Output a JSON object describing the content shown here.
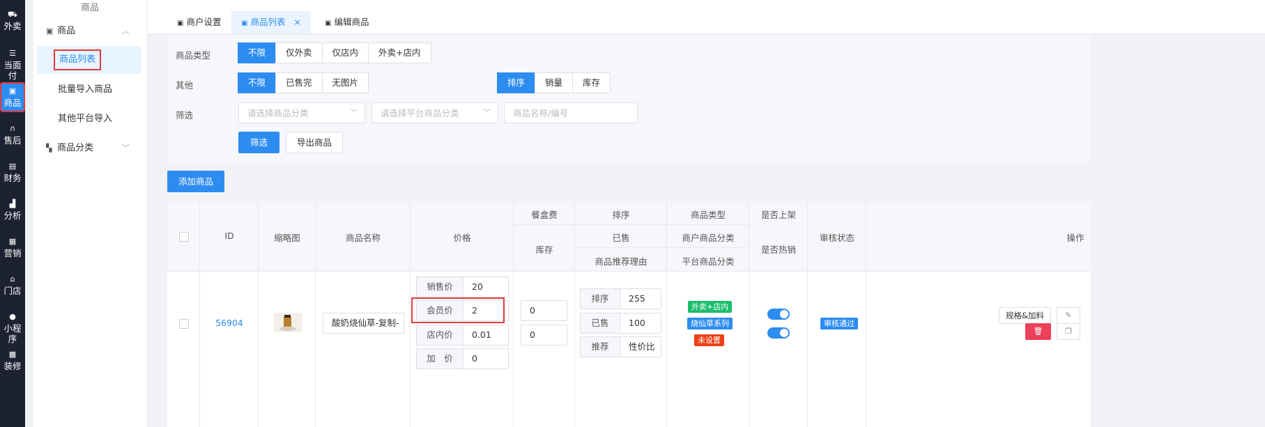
{
  "rail": [
    {
      "icon": "takeout-icon",
      "glyph": "⛟",
      "label": "外卖"
    },
    {
      "icon": "list-icon",
      "glyph": "☰",
      "label": "当面付"
    },
    {
      "icon": "shop-basket-icon",
      "glyph": "▣",
      "label": "商品",
      "active": true
    },
    {
      "icon": "headset-icon",
      "glyph": "∩",
      "label": "售后"
    },
    {
      "icon": "finance-icon",
      "glyph": "▤",
      "label": "财务"
    },
    {
      "icon": "bar-chart-icon",
      "glyph": "▟",
      "label": "分析"
    },
    {
      "icon": "gift-icon",
      "glyph": "▦",
      "label": "营销"
    },
    {
      "icon": "store-icon",
      "glyph": "⌂",
      "label": "门店"
    },
    {
      "icon": "chat-icon",
      "glyph": "●",
      "label": "小程序"
    },
    {
      "icon": "decorate-icon",
      "glyph": "▩",
      "label": "装修"
    }
  ],
  "submenu": {
    "group_title": "商品",
    "goods_group": "商品",
    "items": [
      "商品列表",
      "批量导入商品",
      "其他平台导入"
    ],
    "category_group": "商品分类"
  },
  "tabs": [
    {
      "label": "商户设置"
    },
    {
      "label": "商品列表",
      "close": "×"
    },
    {
      "label": "编辑商品"
    }
  ],
  "filters": {
    "goods_type_label": "商品类型",
    "goods_type_options": [
      "不限",
      "仅外卖",
      "仅店内",
      "外卖+店内"
    ],
    "other_label": "其他",
    "other_options": [
      "不限",
      "已售完",
      "无图片"
    ],
    "sort_options": [
      "排序",
      "销量",
      "库存"
    ],
    "screen_label": "筛选",
    "category_placeholder": "请选择商品分类",
    "platform_category_placeholder": "请选择平台商品分类",
    "name_placeholder": "商品名称/编号",
    "filter_button": "筛选",
    "export_button": "导出商品"
  },
  "add_button": "添加商品",
  "table": {
    "headers": {
      "id": "ID",
      "thumb": "缩略图",
      "name": "商品名称",
      "price": "价格",
      "box_fee": "餐盒费",
      "stock": "库存",
      "sort": "排序",
      "sold": "已售",
      "recommend_reason": "商品推荐理由",
      "goods_type": "商品类型",
      "merchant_category": "商户商品分类",
      "platform_category": "平台商品分类",
      "on_shelf": "是否上架",
      "hot": "是否热销",
      "audit": "审核状态",
      "ops": "操作"
    },
    "row": {
      "id": "56904",
      "name": "酸奶烧仙草-复制-",
      "prices": [
        {
          "k": "销售价",
          "v": "20"
        },
        {
          "k": "会员价",
          "v": "2"
        },
        {
          "k": "店内价",
          "v": "0.01"
        },
        {
          "k": "加　价",
          "v": "0"
        }
      ],
      "box_fee": "0",
      "stock": "0",
      "sort_fields": [
        {
          "k": "排序",
          "v": "255"
        },
        {
          "k": "已售",
          "v": "100"
        },
        {
          "k": "推荐",
          "v": "性价比"
        }
      ],
      "tags": [
        {
          "text": "外卖+店内",
          "color": "#19be6b"
        },
        {
          "text": "烧仙草系列",
          "color": "#2d8cf0"
        },
        {
          "text": "未设置",
          "color": "#ed4014"
        }
      ],
      "on_shelf": true,
      "hot": true,
      "audit_status": "审核通过",
      "spec_button": "规格&加料"
    }
  },
  "colors": {
    "primary": "#2d8cf0",
    "highlight": "#e5393a",
    "rail_bg": "#1d2233"
  }
}
